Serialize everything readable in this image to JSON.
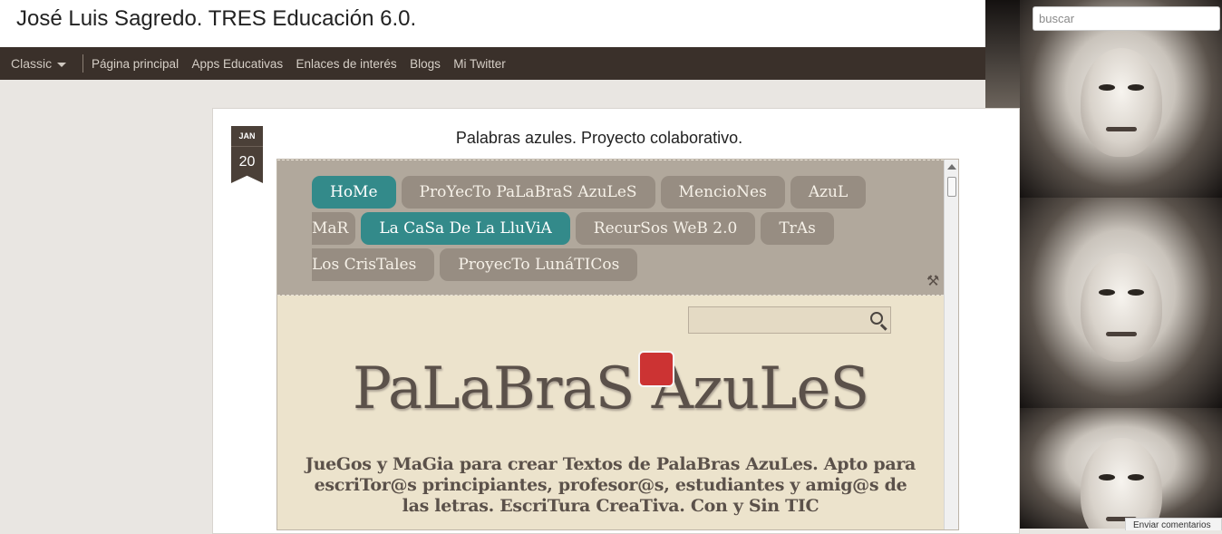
{
  "header": {
    "title": "José Luis Sagredo. TRES Educación 6.0."
  },
  "nav": {
    "view_label": "Classic",
    "links": [
      "Página principal",
      "Apps Educativas",
      "Enlaces de interés",
      "Blogs",
      "Mi Twitter"
    ]
  },
  "search": {
    "placeholder": "buscar"
  },
  "post": {
    "date_month": "JAN",
    "date_day": "20",
    "title": "Palabras azules. Proyecto colaborativo."
  },
  "embedded_site": {
    "menu_row1": [
      "HoMe",
      "ProYecTo PaLaBraS AzuLeS",
      "MencioNes",
      "AzuL"
    ],
    "menu_row2": [
      "MaR",
      "La CaSa De La LluViA",
      "RecurSos WeB 2.0",
      "TrAs"
    ],
    "menu_row3": [
      "Los CrisTales",
      "ProyecTo LunáTICos"
    ],
    "site_title": "PaLaBraS AzuLeS",
    "site_description": "JueGos y MaGia para crear Textos de PalaBras AzuLes. Apto para escriTor@s principiantes, profesor@s, estudiantes y amig@s de las letras. EscriTura CreaTiva. Con y Sin TIC"
  },
  "comment_tab": {
    "label": "Enviar comentarios"
  },
  "icons": [
    "caret-down-icon",
    "tools-icon",
    "search-icon",
    "scroll-up-arrow-icon"
  ]
}
